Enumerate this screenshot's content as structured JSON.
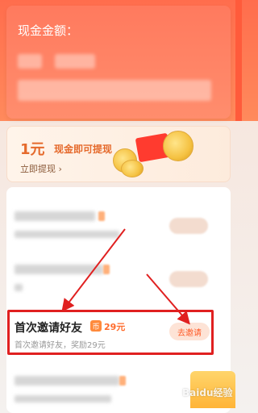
{
  "header": {
    "title": "现金金额："
  },
  "banner": {
    "highlight_amount": "1元",
    "text": "现金即可提现",
    "link": "立即提现 ›"
  },
  "task": {
    "title": "首次邀请好友",
    "reward_badge": "币",
    "reward_amount": "29元",
    "description": "首次邀请好友，奖励29元",
    "button": "去邀请"
  },
  "watermark": {
    "text": "Baidu经验"
  },
  "colors": {
    "accent": "#ff5a26",
    "highlight_border": "#e02020"
  }
}
